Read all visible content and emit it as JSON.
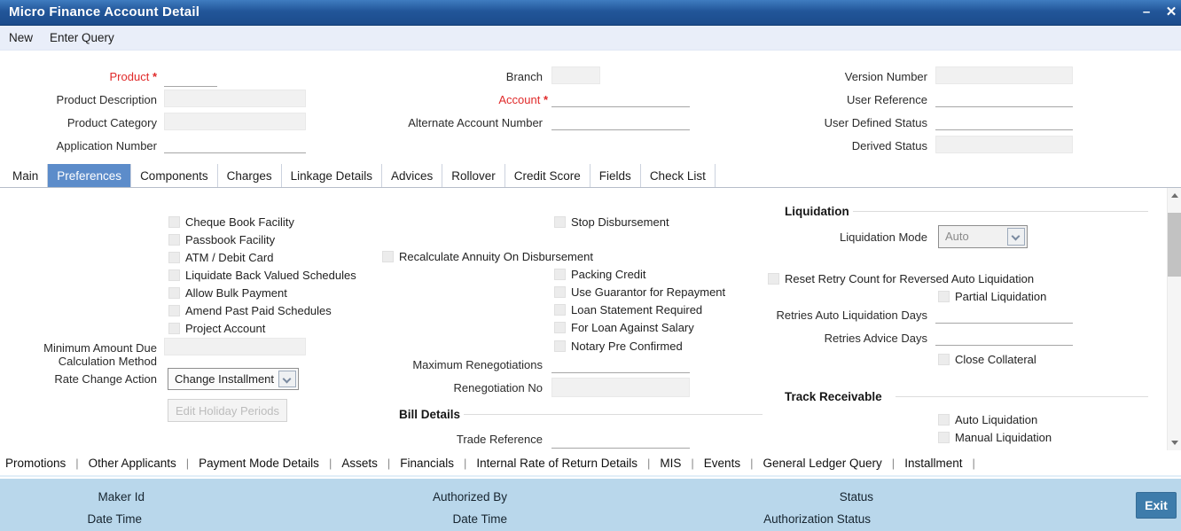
{
  "window": {
    "title": "Micro Finance Account Detail",
    "minimize_glyph": "–",
    "close_glyph": "✕"
  },
  "menu": {
    "new_label": "New",
    "enter_query_label": "Enter Query"
  },
  "required_marker": "*",
  "form": {
    "product_label": "Product",
    "product_description_label": "Product Description",
    "product_category_label": "Product Category",
    "application_number_label": "Application Number",
    "branch_label": "Branch",
    "account_label": "Account",
    "alternate_account_number_label": "Alternate Account Number",
    "version_number_label": "Version Number",
    "user_reference_label": "User Reference",
    "user_defined_status_label": "User Defined Status",
    "derived_status_label": "Derived Status"
  },
  "tabs": [
    "Main",
    "Preferences",
    "Components",
    "Charges",
    "Linkage Details",
    "Advices",
    "Rollover",
    "Credit Score",
    "Fields",
    "Check List"
  ],
  "selected_tab": "Preferences",
  "preferences": {
    "checkboxes_left": [
      "Cheque Book Facility",
      "Passbook Facility",
      "ATM / Debit Card",
      "Liquidate Back Valued Schedules",
      "Allow Bulk Payment",
      "Amend Past Paid Schedules",
      "Project Account"
    ],
    "stop_disbursement_label": "Stop Disbursement",
    "recalculate_annuity_label": "Recalculate Annuity On Disbursement",
    "checkboxes_mid": [
      "Packing Credit",
      "Use Guarantor for Repayment",
      "Loan Statement Required",
      "For Loan Against Salary",
      "Notary Pre Confirmed"
    ],
    "minimum_amount_due_line1": "Minimum Amount Due",
    "minimum_amount_due_line2": "Calculation Method",
    "rate_change_action_label": "Rate Change Action",
    "rate_change_action_value": "Change Installment",
    "edit_holiday_periods_label": "Edit Holiday Periods",
    "maximum_renegotiations_label": "Maximum Renegotiations",
    "renegotiation_no_label": "Renegotiation No",
    "bill_details_header": "Bill Details",
    "trade_reference_label": "Trade Reference"
  },
  "liquidation": {
    "header": "Liquidation",
    "mode_label": "Liquidation Mode",
    "mode_value": "Auto",
    "reset_retry_label": "Reset Retry Count for Reversed Auto Liquidation",
    "partial_liquidation_label": "Partial Liquidation",
    "retries_auto_days_label": "Retries Auto Liquidation Days",
    "retries_advice_days_label": "Retries Advice Days",
    "close_collateral_label": "Close Collateral"
  },
  "track_receivable": {
    "header": "Track Receivable",
    "auto_liquidation_label": "Auto Liquidation",
    "manual_liquidation_label": "Manual Liquidation"
  },
  "links": [
    "Promotions",
    "Other Applicants",
    "Payment Mode Details",
    "Assets",
    "Financials",
    "Internal Rate of Return Details",
    "MIS",
    "Events",
    "General Ledger Query",
    "Installment"
  ],
  "link_separator": "|",
  "footer": {
    "maker_id_label": "Maker Id",
    "date_time_label_1": "Date Time",
    "authorized_by_label": "Authorized By",
    "date_time_label_2": "Date Time",
    "status_label": "Status",
    "authorization_status_label": "Authorization Status",
    "exit_label": "Exit"
  },
  "colors": {
    "titlebar_blue": "#1d4f92",
    "selected_tab_blue": "#5c8cca",
    "footer_blue": "#b9d7eb",
    "exit_button_blue": "#3e7cab",
    "required_red": "#e02a2a"
  }
}
